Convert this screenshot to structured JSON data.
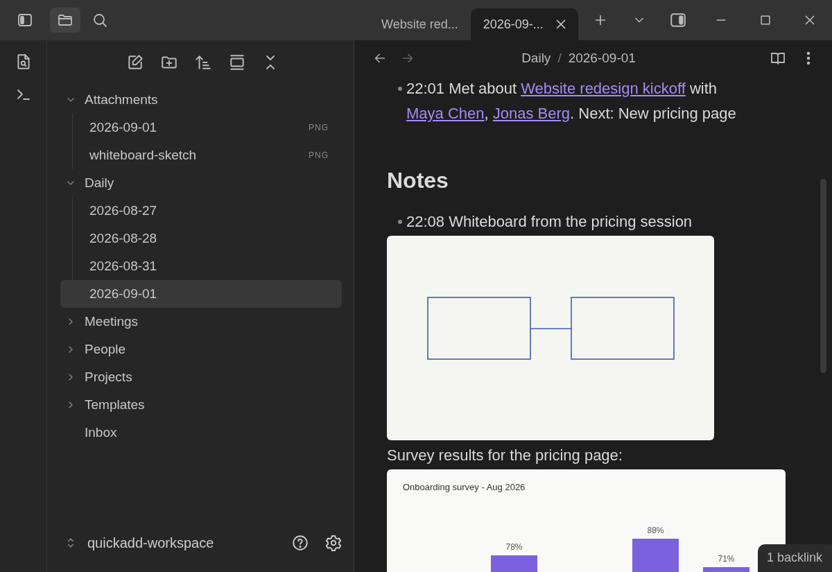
{
  "titlebar": {
    "buttons": [
      {
        "kind": "files",
        "selected": true
      },
      {
        "kind": "search",
        "selected": false
      }
    ],
    "tabs": [
      {
        "label": "Website red...",
        "selected": false
      },
      {
        "label": "2026-09-...",
        "selected": true
      }
    ]
  },
  "sidebar": {
    "tree": [
      {
        "label": "Attachments",
        "kind": "folder",
        "expanded": true,
        "selected": false,
        "children": [
          {
            "label": "2026-09-01",
            "kind": "file",
            "badge": "PNG",
            "selected": false
          },
          {
            "label": "whiteboard-sketch",
            "kind": "file",
            "badge": "PNG",
            "selected": false
          }
        ]
      },
      {
        "label": "Daily",
        "kind": "folder",
        "expanded": true,
        "selected": false,
        "children": [
          {
            "label": "2026-08-27",
            "kind": "file",
            "selected": false
          },
          {
            "label": "2026-08-28",
            "kind": "file",
            "selected": false
          },
          {
            "label": "2026-08-31",
            "kind": "file",
            "selected": false
          },
          {
            "label": "2026-09-01",
            "kind": "file",
            "selected": true
          }
        ]
      },
      {
        "label": "Meetings",
        "kind": "folder",
        "expanded": false,
        "selected": false
      },
      {
        "label": "People",
        "kind": "folder",
        "expanded": false,
        "selected": false
      },
      {
        "label": "Projects",
        "kind": "folder",
        "expanded": false,
        "selected": false
      },
      {
        "label": "Templates",
        "kind": "folder",
        "expanded": false,
        "selected": false
      },
      {
        "label": "Inbox",
        "kind": "file",
        "selected": false
      }
    ],
    "vault": "quickadd-workspace"
  },
  "editor": {
    "nav": {
      "back_disabled": false,
      "forward_disabled": true
    },
    "breadcrumb": [
      "Daily",
      "/",
      "2026-09-01"
    ],
    "blocks": [
      {
        "kind": "bullet",
        "segments": [
          {
            "text": "22:01 Met about "
          },
          {
            "text": "Website redesign kickoff",
            "link": true
          },
          {
            "text": " with "
          },
          {
            "text": "Maya Chen",
            "link": true
          },
          {
            "text": ", "
          },
          {
            "text": "Jonas Berg",
            "link": true
          },
          {
            "text": ". Next: New pricing page"
          }
        ]
      },
      {
        "kind": "heading",
        "text": "Notes"
      },
      {
        "kind": "bullet",
        "segments": [
          {
            "text": "22:08 Whiteboard from the pricing session"
          }
        ]
      },
      {
        "kind": "image"
      },
      {
        "kind": "paragraph",
        "text": "Survey results for the pricing page:"
      },
      {
        "kind": "chart",
        "title": "Onboarding survey - Aug 2026",
        "bar_labels": [
          "78%",
          "88%",
          "71%"
        ]
      }
    ],
    "backlinks": "1 backlink"
  }
}
